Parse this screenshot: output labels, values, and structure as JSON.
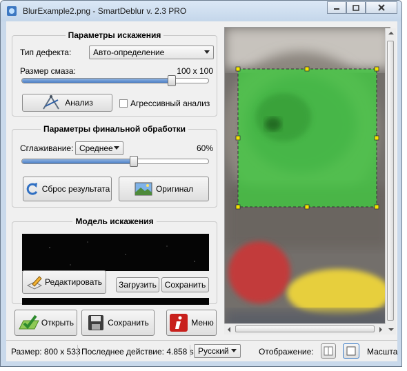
{
  "window": {
    "title": "BlurExample2.png - SmartDeblur v. 2.3 PRO"
  },
  "distortion": {
    "title": "Параметры искажения",
    "defect_label": "Тип дефекта:",
    "defect_value": "Авто-определение",
    "blur_label": "Размер смаза:",
    "blur_value": "100 x 100",
    "blur_level": 0.8,
    "analyze_label": "Анализ",
    "aggressive_label": "Агрессивный анализ",
    "aggressive_checked": false
  },
  "final": {
    "title": "Параметры финальной обработки",
    "smoothing_label": "Сглаживание:",
    "smoothing_value": "Среднее",
    "smoothing_percent": "60%",
    "smoothing_level": 0.6,
    "reset_label": "Сброс результата",
    "original_label": "Оригинал"
  },
  "model": {
    "title": "Модель искажения",
    "edit_label": "Редактировать",
    "load_label": "Загрузить",
    "save_label": "Сохранить"
  },
  "bottom_buttons": {
    "open_label": "Открыть",
    "save_label": "Сохранить",
    "menu_label": "Меню"
  },
  "status": {
    "size": "Размер: 800 x 533",
    "last_action": "Последнее действие: 4.858 s",
    "language": "Русский",
    "display_label": "Отображение:",
    "scale_label": "Масшта"
  },
  "colors": {
    "selection": "#3fd03f",
    "accent": "#4b7fc7",
    "menu_red": "#c8201c"
  },
  "icons": [
    "app-icon",
    "analyze-icon",
    "reset-icon",
    "original-icon",
    "edit-icon",
    "open-icon",
    "save-icon",
    "menu-icon"
  ]
}
